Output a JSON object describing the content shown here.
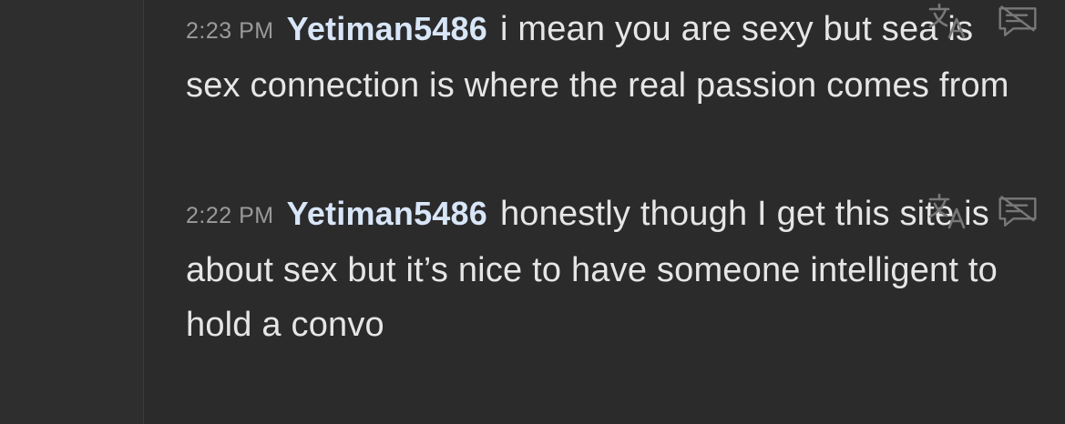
{
  "messages": [
    {
      "time": "2:23 PM",
      "username": "Yetiman5486",
      "text_first": "i mean you",
      "text_rest": "are sexy but sea is sex connection is where the real passion comes from"
    },
    {
      "time": "2:22 PM",
      "username": "Yetiman5486",
      "text_first": "honestly",
      "text_rest": "though I get this site is about sex but it’s nice to have someone intelligent to hold a convo"
    }
  ],
  "icons": {
    "translate": "translate-icon",
    "hide": "hide-message-icon"
  },
  "colors": {
    "background": "#2b2b2b",
    "username": "#d8e6f8",
    "timestamp": "#9a9a9a",
    "text": "#e6e6e6",
    "icon": "#777777"
  }
}
